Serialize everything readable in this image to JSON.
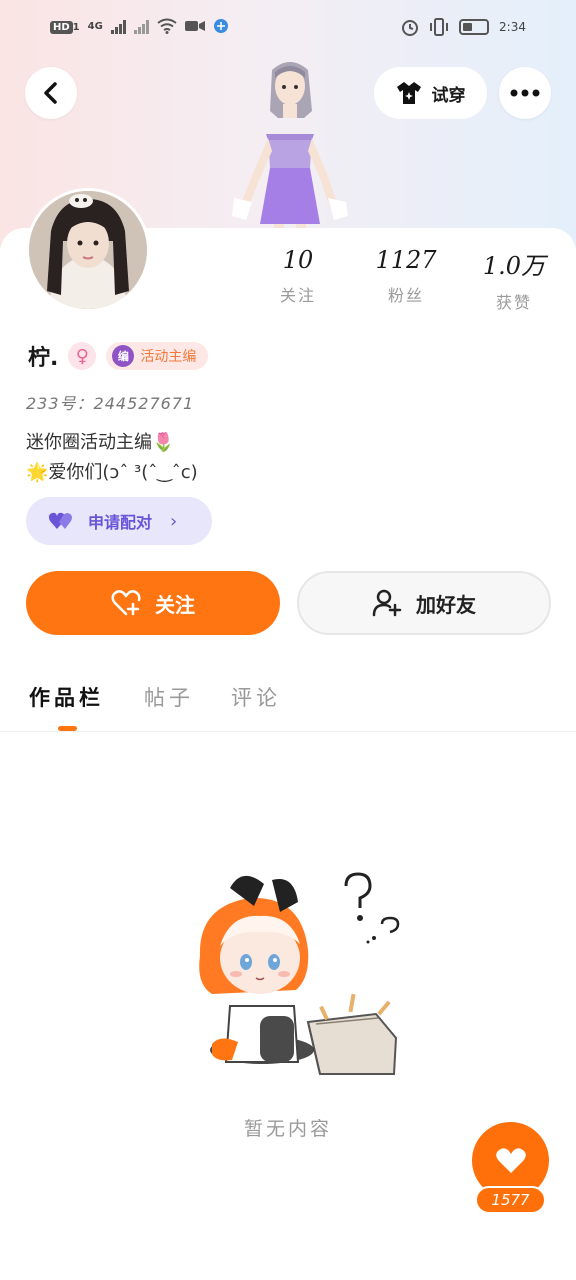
{
  "status_bar": {
    "hd_badge": "HD",
    "hd_sub": "1",
    "network": "4G",
    "time": "2:34"
  },
  "header": {
    "back_icon": "chevron-left-icon",
    "tryon_label": "试穿",
    "tryon_icon": "tshirt-icon",
    "more_icon": "more-dots-icon"
  },
  "profile": {
    "stats": [
      {
        "value": "10",
        "label": "关注"
      },
      {
        "value": "1127",
        "label": "粉丝"
      },
      {
        "value": "1.0万",
        "label": "获赞"
      }
    ],
    "name": "柠.",
    "gender_symbol": "♀",
    "role_icon_text": "编",
    "role_badge": "活动主编",
    "uid": "233号：244527671",
    "bio_line1": "迷你圈活动主编🌷",
    "bio_line2": "🌟爱你们(ɔˆ ³(ˆ‿ˆc)",
    "pair_label": "申请配对",
    "pair_chevron": "›"
  },
  "actions": {
    "follow_label": "关注",
    "add_friend_label": "加好友"
  },
  "tabs": [
    {
      "label": "作品栏",
      "active": true
    },
    {
      "label": "帖子",
      "active": false
    },
    {
      "label": "评论",
      "active": false
    }
  ],
  "empty_state": {
    "text": "暂无内容"
  },
  "like_fab": {
    "count": "1577"
  },
  "colors": {
    "accent": "#ff7512",
    "pair_bg": "#e8e6fb",
    "pair_fg": "#6a55d8"
  }
}
